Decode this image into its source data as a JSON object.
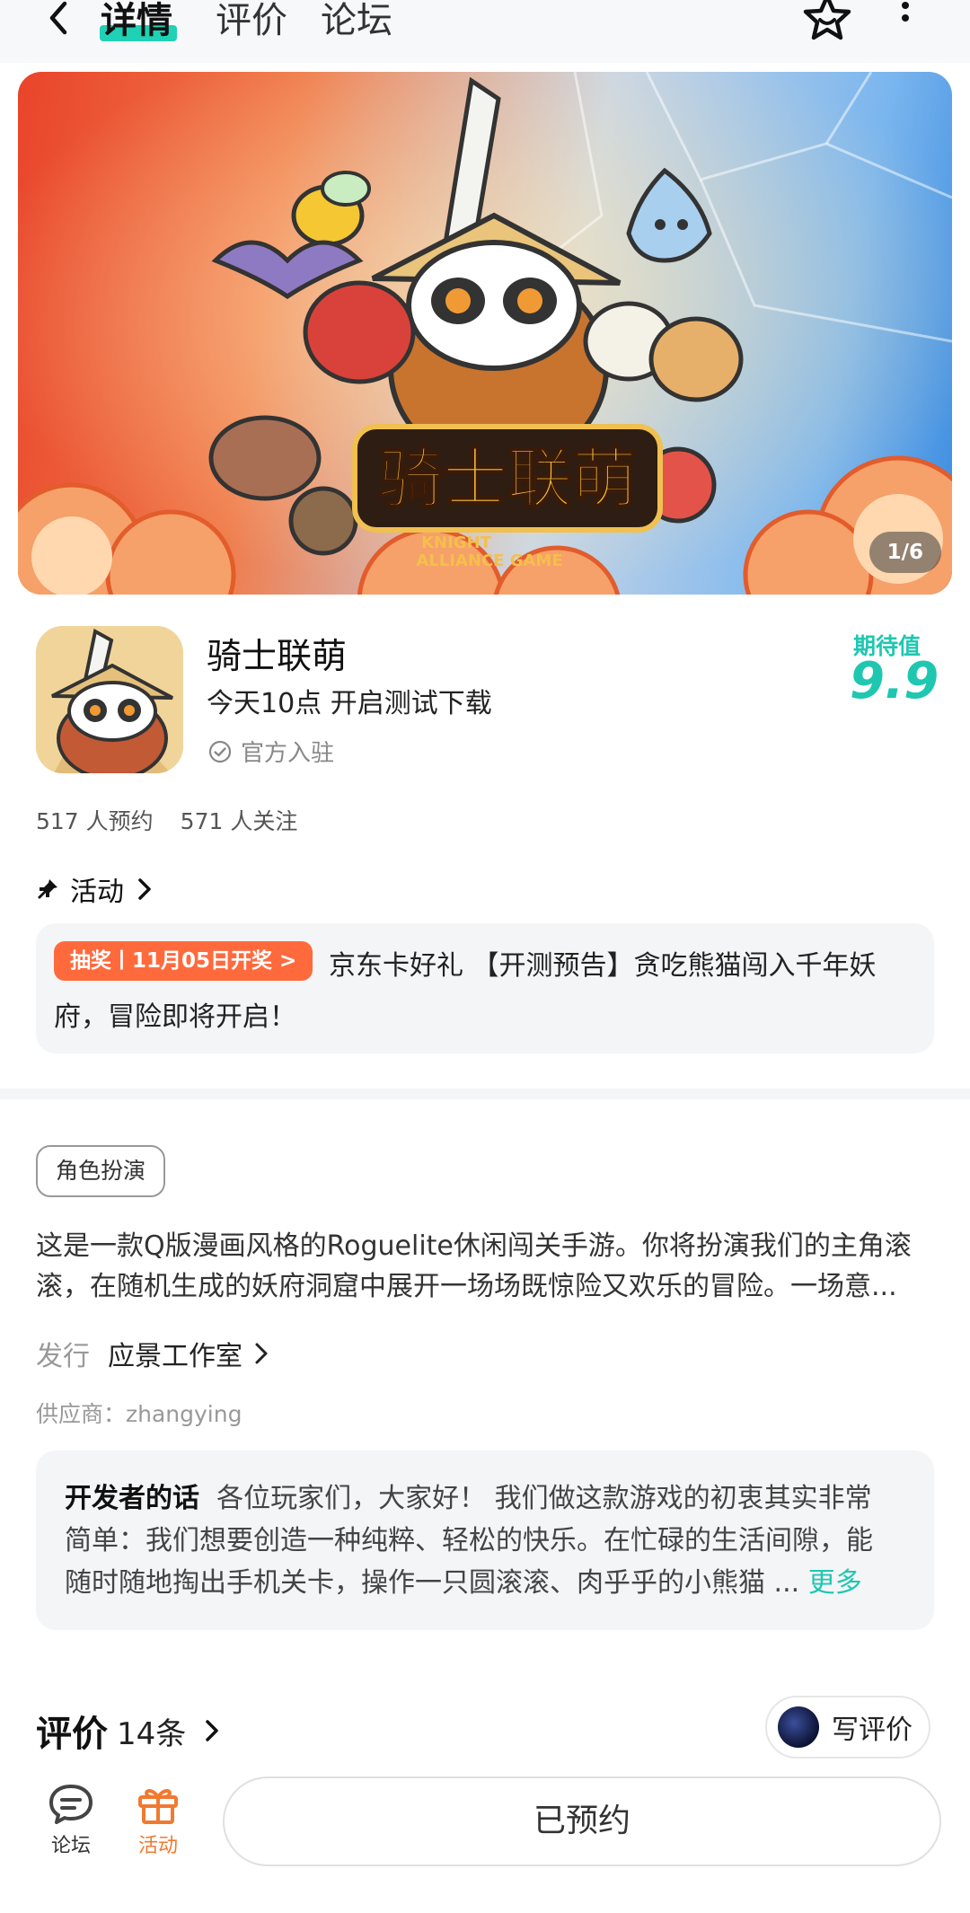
{
  "header": {
    "tabs": [
      {
        "label": "详情",
        "active": true
      },
      {
        "label": "评价",
        "active": false
      },
      {
        "label": "论坛",
        "active": false
      }
    ],
    "icons": [
      "back-icon",
      "star-icon",
      "more-icon"
    ]
  },
  "banner": {
    "counter": "1/6",
    "logo_cn": "骑士联萌",
    "logo_en_line1": "KNIGHT",
    "logo_en_line2": "ALLIANCE GAME"
  },
  "app": {
    "name": "骑士联萌",
    "subtitle": "今天10点 开启测试下载",
    "official": "官方入驻",
    "expectation_label": "期待值",
    "expectation_value": "9.9",
    "reservations": "517 人预约",
    "followers": "571 人关注"
  },
  "activity": {
    "heading": "活动",
    "badge": "抽奖丨11月05日开奖 >",
    "text_line1": "京东卡好礼 【开测预告】贪吃熊猫闯入千年妖",
    "text_line2": "府，冒险即将开启！"
  },
  "details": {
    "genre": "角色扮演",
    "description_line1": "这是一款Q版漫画风格的Roguelite休闲闯关手游。你将扮演我们的主角滚",
    "description_line2": "滚，在随机生成的妖府洞窟中展开一场场既惊险又欢乐的冒险。一场意...",
    "publisher_label": "发行",
    "publisher_name": "应景工作室",
    "supplier": "供应商：zhangying"
  },
  "developer": {
    "title": "开发者的话",
    "text_line1": "各位玩家们，大家好！ 我们做这款游戏的初衷其实非常",
    "text_line2": "简单：我们想要创造一种纯粹、轻松的快乐。在忙碌的生活间隙，能",
    "text_line3": "随时随地掏出手机关卡，操作一只圆滚滚、肉乎乎的小熊猫 ...",
    "more": "更多"
  },
  "reviews": {
    "title": "评价",
    "count": "14条",
    "write_label": "写评价"
  },
  "bottom_nav": {
    "forum_label": "论坛",
    "activity_label": "活动",
    "reserved_label": "已预约"
  },
  "colors": {
    "accent": "#1fc7b0",
    "badge": "#ff6a3d",
    "activity_nav": "#f07a30"
  }
}
